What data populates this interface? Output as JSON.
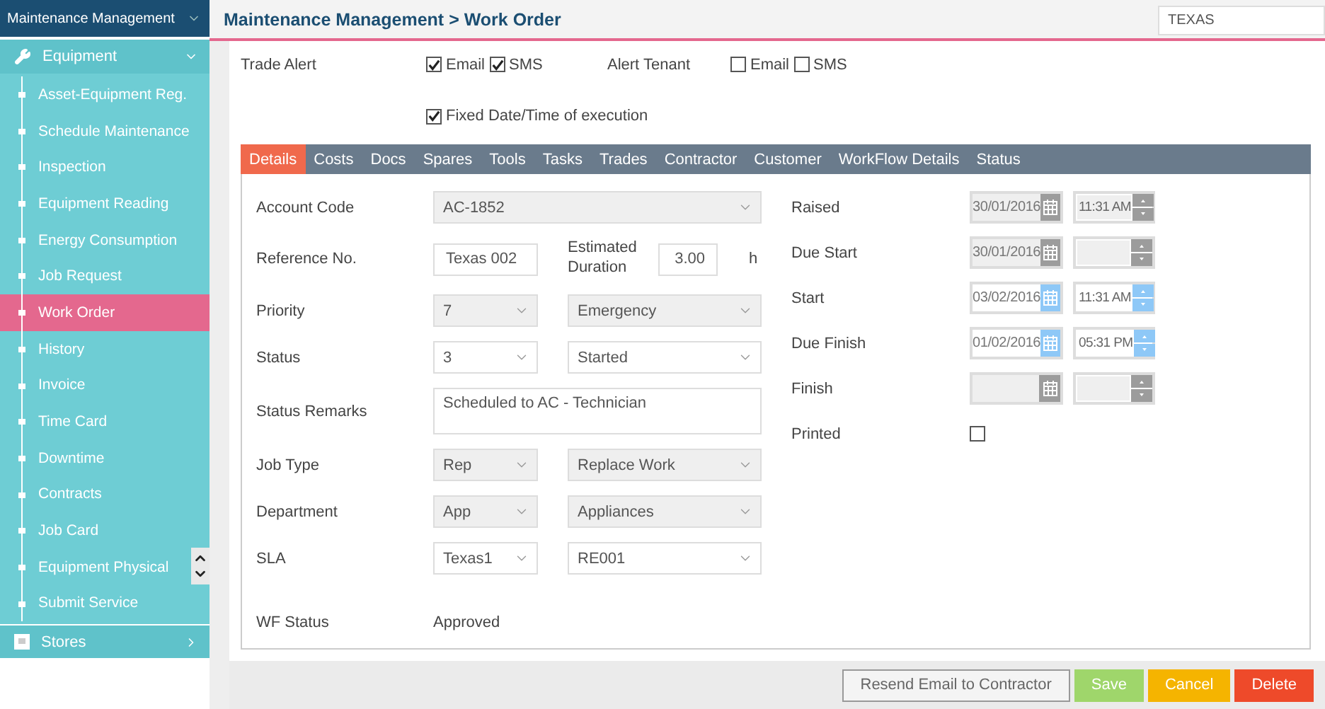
{
  "sidebar": {
    "title": "Maintenance Management",
    "groups": [
      {
        "label": "Equipment",
        "expanded": true,
        "items": [
          {
            "label": "Asset-Equipment Reg.",
            "selected": false
          },
          {
            "label": "Schedule Maintenance",
            "selected": false
          },
          {
            "label": "Inspection",
            "selected": false
          },
          {
            "label": "Equipment Reading",
            "selected": false
          },
          {
            "label": "Energy Consumption",
            "selected": false
          },
          {
            "label": "Job Request",
            "selected": false
          },
          {
            "label": "Work Order",
            "selected": true
          },
          {
            "label": "History",
            "selected": false
          },
          {
            "label": "Invoice",
            "selected": false
          },
          {
            "label": "Time Card",
            "selected": false
          },
          {
            "label": "Downtime",
            "selected": false
          },
          {
            "label": "Contracts",
            "selected": false
          },
          {
            "label": "Job Card",
            "selected": false
          },
          {
            "label": "Equipment Physical",
            "selected": false
          },
          {
            "label": "Submit Service",
            "selected": false
          }
        ]
      },
      {
        "label": "Stores",
        "expanded": false
      }
    ]
  },
  "header": {
    "breadcrumb": "Maintenance Management > Work Order",
    "search_value": "TEXAS"
  },
  "alerts": {
    "trade_alert": {
      "label": "Trade Alert",
      "options": [
        {
          "label": "Email",
          "checked": true
        },
        {
          "label": "SMS",
          "checked": true
        }
      ]
    },
    "alert_tenant": {
      "label": "Alert Tenant",
      "options": [
        {
          "label": "Email",
          "checked": false
        },
        {
          "label": "SMS",
          "checked": false
        }
      ]
    },
    "fixed_date": {
      "label": "Fixed Date/Time of execution",
      "checked": true
    }
  },
  "tabs": [
    {
      "label": "Details",
      "selected": true
    },
    {
      "label": "Costs",
      "selected": false
    },
    {
      "label": "Docs",
      "selected": false
    },
    {
      "label": "Spares",
      "selected": false
    },
    {
      "label": "Tools",
      "selected": false
    },
    {
      "label": "Tasks",
      "selected": false
    },
    {
      "label": "Trades",
      "selected": false
    },
    {
      "label": "Contractor",
      "selected": false
    },
    {
      "label": "Customer",
      "selected": false
    },
    {
      "label": "WorkFlow Details",
      "selected": false
    },
    {
      "label": "Status",
      "selected": false
    }
  ],
  "left_fields": [
    {
      "kind": "select",
      "label": "Account Code",
      "value": "AC-1852",
      "disabled": true
    },
    {
      "kind": "reference",
      "label": "Reference No.",
      "value": "Texas 002",
      "extra_label": "Estimated Duration",
      "extra_value": "3.00",
      "unit": "h"
    },
    {
      "kind": "select_pair",
      "label": "Priority",
      "code": "7",
      "value": "Emergency",
      "disabled": true
    },
    {
      "kind": "select_pair",
      "label": "Status",
      "code": "3",
      "value": "Started",
      "disabled": false
    },
    {
      "kind": "textarea",
      "label": "Status Remarks",
      "value": "Scheduled to AC - Technician"
    },
    {
      "kind": "select_pair",
      "label": "Job Type",
      "code": "Rep",
      "value": "Replace Work",
      "disabled": true
    },
    {
      "kind": "select_pair",
      "label": "Department",
      "code": "App",
      "value": "Appliances",
      "disabled": true
    },
    {
      "kind": "select_pair",
      "label": "SLA",
      "code": "Texas1",
      "value": "RE001",
      "disabled": false
    },
    {
      "kind": "text",
      "label": "WF Status",
      "value": "Approved"
    }
  ],
  "right_fields": [
    {
      "kind": "datetime",
      "label": "Raised",
      "date": "30/01/2016",
      "time": "11:31 AM",
      "disabled": true
    },
    {
      "kind": "datetime",
      "label": "Due Start",
      "date": "30/01/2016",
      "disabled": true
    },
    {
      "kind": "datetime",
      "label": "Start",
      "date": "03/02/2016",
      "time": "11:31 AM",
      "disabled": false
    },
    {
      "kind": "datetime",
      "label": "Due Finish",
      "date": "01/02/2016",
      "time": "05:31 PM",
      "disabled": false
    },
    {
      "kind": "datetime",
      "label": "Finish",
      "disabled": true
    },
    {
      "kind": "checkbox",
      "label": "Printed",
      "checked": false
    }
  ],
  "buttons": [
    {
      "label": "Resend Email to Contractor",
      "kind": "default"
    },
    {
      "label": "Save",
      "kind": "save"
    },
    {
      "label": "Cancel",
      "kind": "cancel"
    },
    {
      "label": "Delete",
      "kind": "delete"
    }
  ]
}
